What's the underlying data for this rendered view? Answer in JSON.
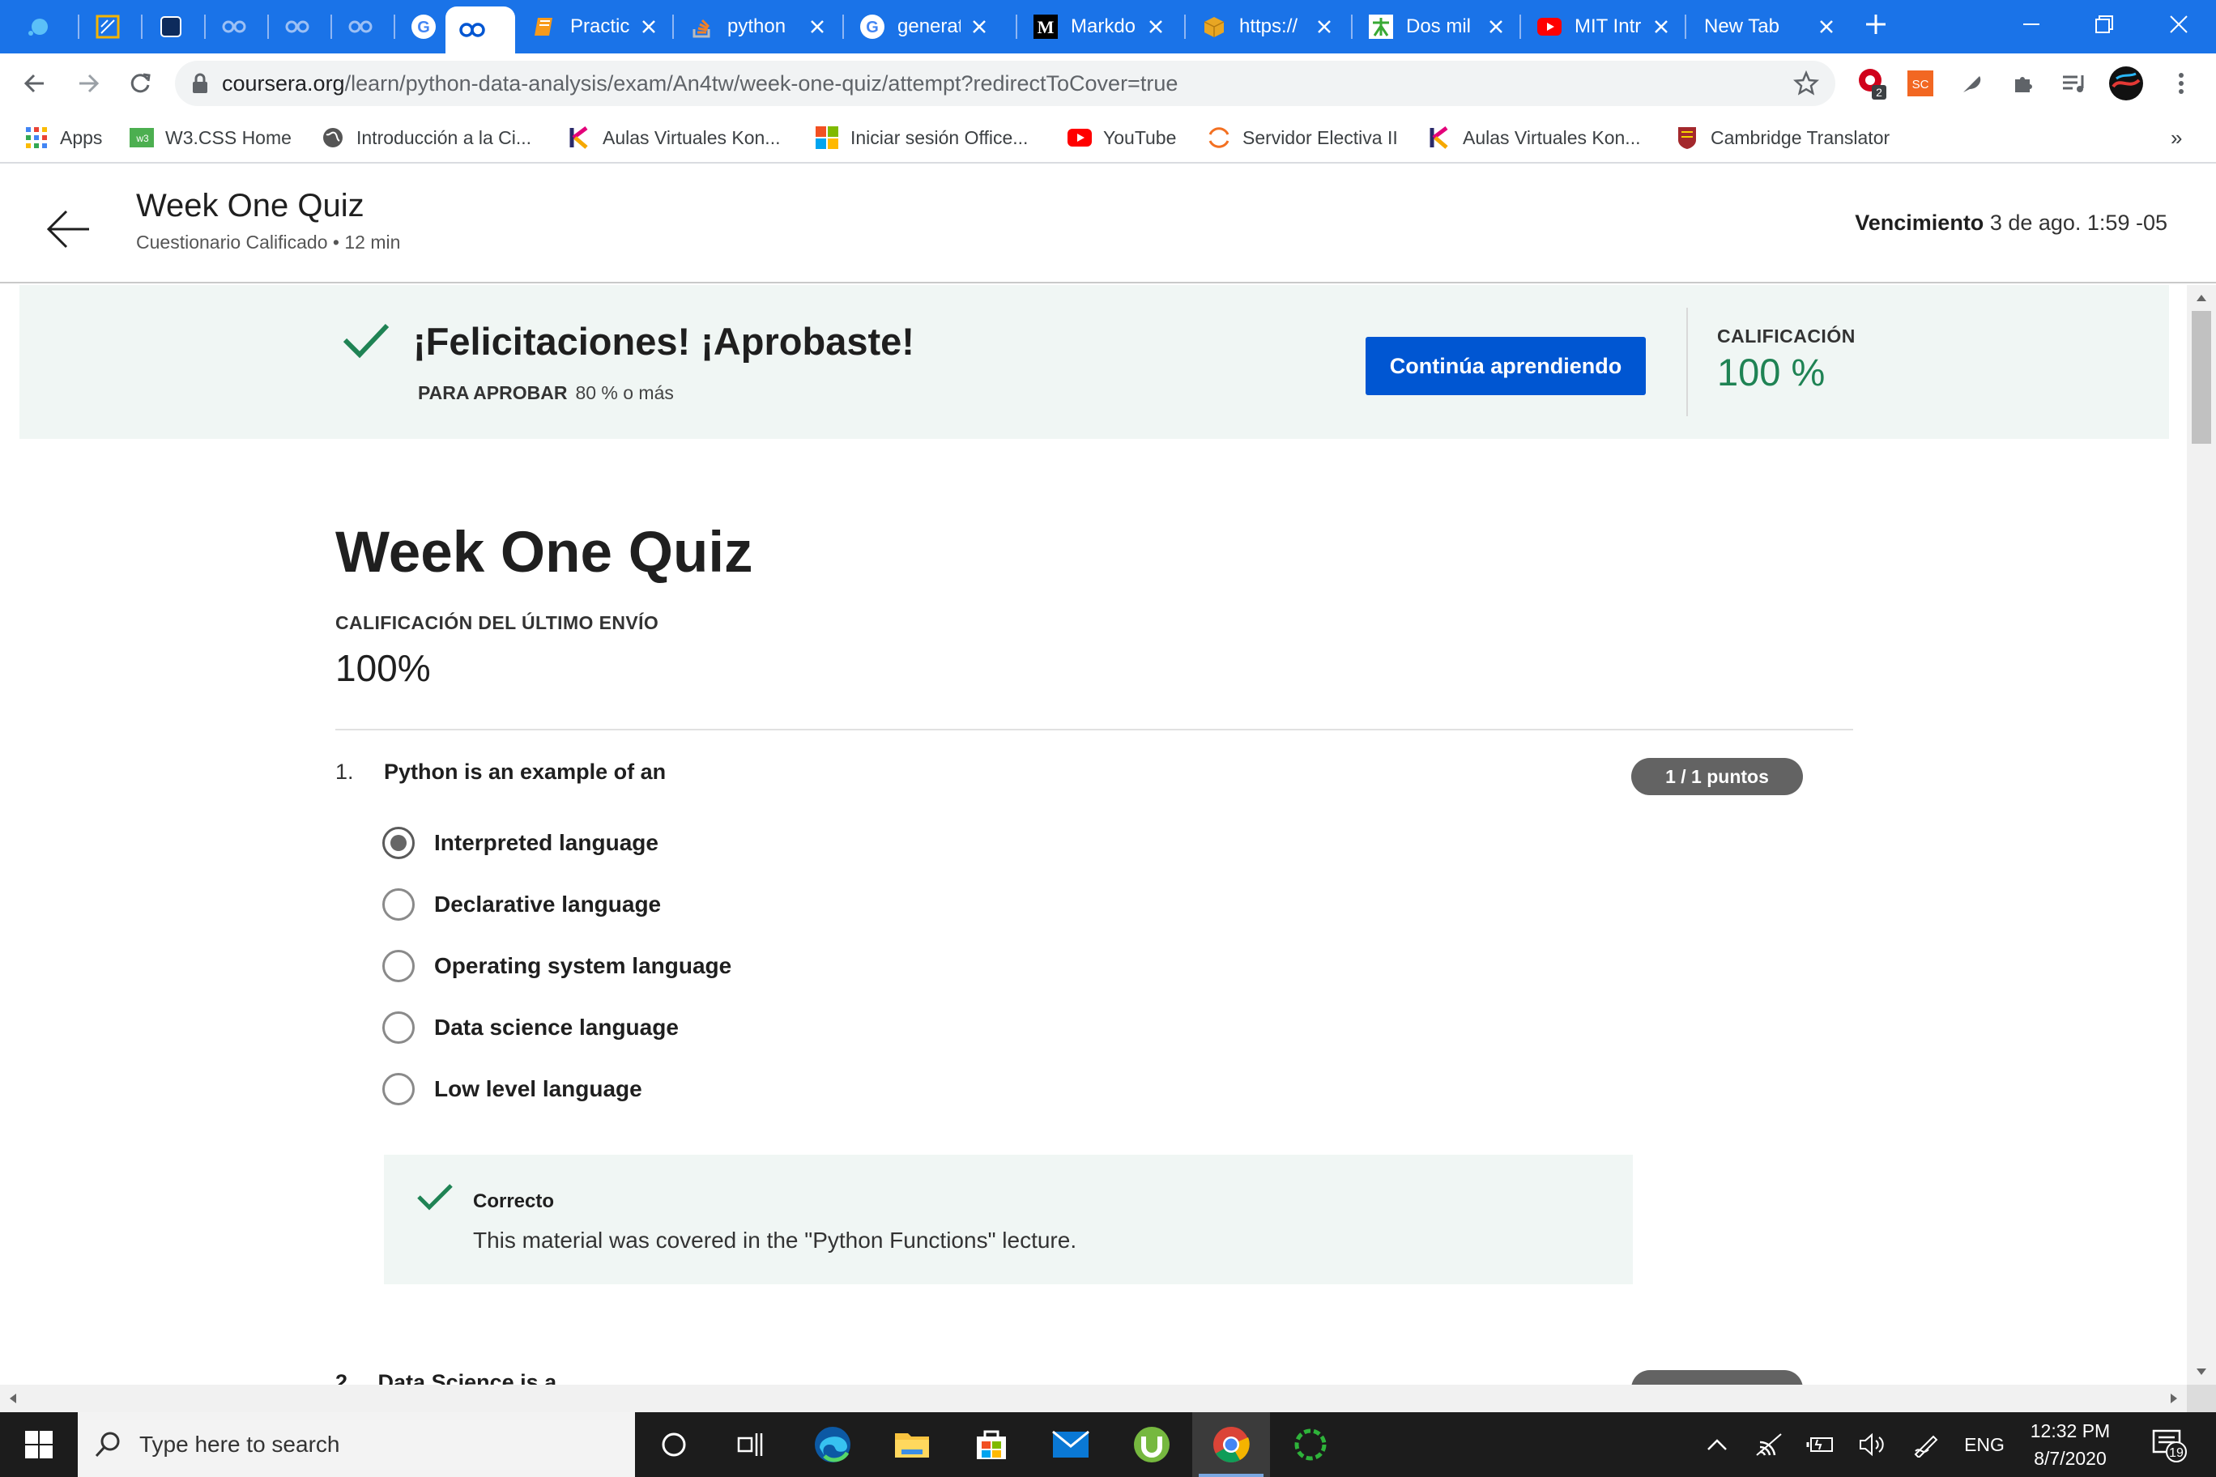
{
  "browser": {
    "tabs": [
      {
        "label": "",
        "icon": "dot-icon"
      },
      {
        "label": "",
        "icon": "document-icon"
      },
      {
        "label": "",
        "icon": "square-icon"
      },
      {
        "label": "",
        "icon": "coursera-icon"
      },
      {
        "label": "",
        "icon": "coursera-icon"
      },
      {
        "label": "",
        "icon": "coursera-icon"
      },
      {
        "label": "",
        "icon": "google-icon"
      },
      {
        "label": "",
        "icon": "coursera-icon",
        "active": true
      },
      {
        "label": "Practice",
        "icon": "book-icon"
      },
      {
        "label": "python",
        "icon": "stackoverflow-icon"
      },
      {
        "label": "generat",
        "icon": "google-icon"
      },
      {
        "label": "Markdo",
        "icon": "medium-icon"
      },
      {
        "label": "https://",
        "icon": "box-icon"
      },
      {
        "label": "Dos mil",
        "icon": "sena-icon"
      },
      {
        "label": "MIT Intr",
        "icon": "youtube-icon"
      },
      {
        "label": "New Tab",
        "icon": ""
      }
    ],
    "url_domain": "coursera.org",
    "url_path": "/learn/python-data-analysis/exam/An4tw/week-one-quiz/attempt?redirectToCover=true",
    "extension_badge": "2",
    "ext_sc_label": "SC",
    "bookmarks": [
      {
        "label": "Apps",
        "icon": "apps-grid-icon"
      },
      {
        "label": "W3.CSS Home",
        "icon": "w3css-icon"
      },
      {
        "label": "Introducción a la Ci...",
        "icon": "globe-icon"
      },
      {
        "label": "Aulas Virtuales Kon...",
        "icon": "konrad-icon"
      },
      {
        "label": "Iniciar sesión Office...",
        "icon": "microsoft-icon"
      },
      {
        "label": "YouTube",
        "icon": "youtube-icon"
      },
      {
        "label": "Servidor Electiva II",
        "icon": "server-icon"
      },
      {
        "label": "Aulas Virtuales Kon...",
        "icon": "konrad-icon"
      },
      {
        "label": "Cambridge Translator",
        "icon": "cambridge-icon"
      }
    ],
    "bookmarks_overflow": "»"
  },
  "header": {
    "title": "Week One Quiz",
    "meta": "Cuestionario Calificado • 12 min",
    "due_label": "Vencimiento",
    "due_value": "3 de ago. 1:59 -05"
  },
  "banner": {
    "title": "¡Felicitaciones! ¡Aprobaste!",
    "pass_label": "PARA APROBAR",
    "pass_value": "80 % o más",
    "continue_button": "Continúa aprendiendo",
    "grade_label": "CALIFICACIÓN",
    "grade_value": "100 %",
    "color_success": "#1f8354",
    "color_primary": "#0056d2"
  },
  "quiz": {
    "title": "Week One Quiz",
    "last_submission_label": "CALIFICACIÓN DEL ÚLTIMO ENVÍO",
    "last_submission_value": "100%",
    "questions": [
      {
        "number": "1.",
        "text": "Python is an example of an",
        "points": "1 / 1 puntos",
        "options": [
          {
            "label": "Interpreted language",
            "selected": true
          },
          {
            "label": "Declarative language",
            "selected": false
          },
          {
            "label": "Operating system language",
            "selected": false
          },
          {
            "label": "Data science language",
            "selected": false
          },
          {
            "label": "Low level language",
            "selected": false
          }
        ],
        "feedback_title": "Correcto",
        "feedback_text": "This material was covered in the \"Python Functions\" lecture."
      },
      {
        "number": "2.",
        "text": "Data Science is a"
      }
    ]
  },
  "taskbar": {
    "search_placeholder": "Type here to search",
    "lang": "ENG",
    "time": "12:32 PM",
    "date": "8/7/2020",
    "notification_count": "19"
  }
}
